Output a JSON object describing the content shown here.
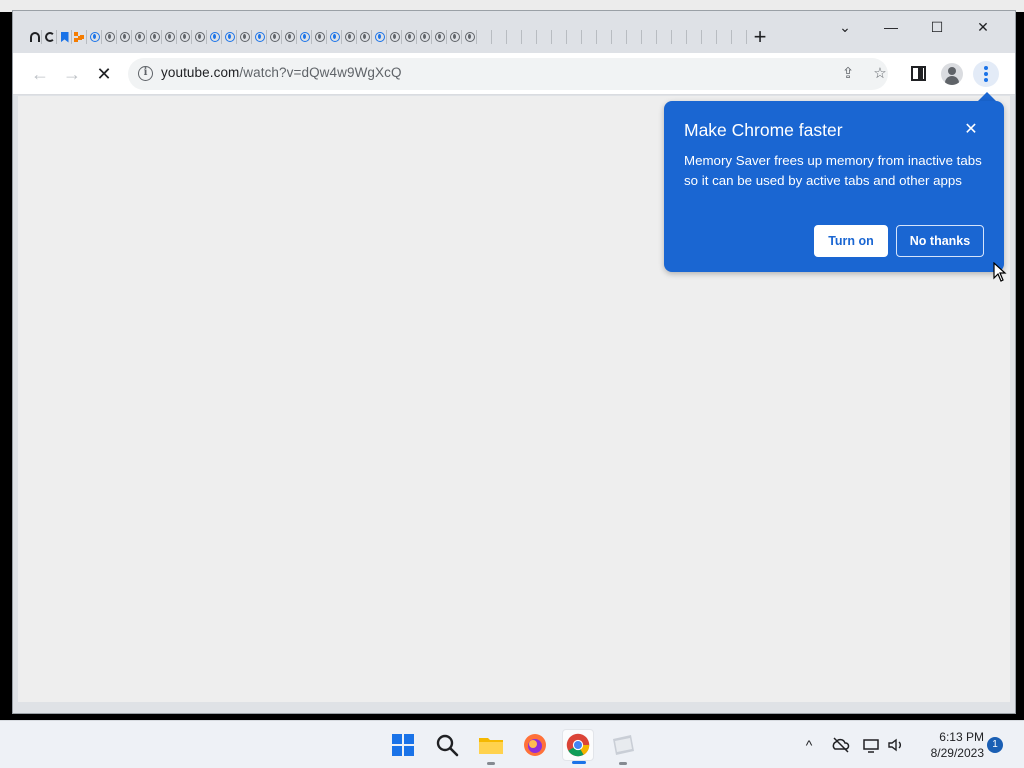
{
  "browser": {
    "tabstrip": {
      "tab_favicons": [
        "headset-icon",
        "reload-icon",
        "bookmark-icon",
        "orange-puzzle-icon",
        "globe-blue-icon",
        "globe-icon",
        "globe-icon",
        "globe-icon",
        "globe-icon",
        "globe-icon",
        "globe-icon",
        "globe-icon",
        "globe-blue-icon",
        "globe-blue-icon",
        "globe-icon",
        "globe-blue-icon",
        "globe-icon",
        "globe-icon",
        "globe-blue-icon",
        "globe-icon",
        "globe-blue-icon",
        "globe-icon",
        "globe-icon",
        "globe-blue-icon",
        "globe-icon",
        "globe-icon",
        "globe-icon",
        "globe-icon",
        "globe-icon",
        "globe-icon",
        "globe-icon",
        "globe-icon",
        "globe-icon",
        "globe-icon",
        "globe-icon",
        "globe-icon",
        "globe-icon",
        "globe-icon",
        "globe-icon",
        "globe-icon",
        "globe-icon",
        "globe-icon",
        "globe-icon",
        "globe-icon",
        "globe-icon",
        "globe-icon",
        "globe-icon",
        "globe-icon"
      ],
      "new_tab_label": "+"
    },
    "window_controls": {
      "tab_search": "⌄",
      "minimize": "—",
      "maximize": "☐",
      "close": "✕"
    },
    "toolbar": {
      "back": "←",
      "forward": "→",
      "stop": "✕",
      "url_host": "youtube.com",
      "url_path": "/watch?v=dQw4w9WgXcQ",
      "share": "⇪",
      "bookmark": "☆"
    }
  },
  "promo": {
    "title": "Make Chrome faster",
    "body": "Memory Saver frees up memory from inactive tabs so it can be used by active tabs and other apps",
    "close": "✕",
    "primary_button": "Turn on",
    "secondary_button": "No thanks",
    "color": "#1a66d2"
  },
  "taskbar": {
    "apps": [
      "start-icon",
      "search-icon",
      "file-explorer-icon",
      "firefox-icon",
      "chrome-icon",
      "app-icon"
    ],
    "tray": {
      "chevron": "^",
      "time": "6:13 PM",
      "date": "8/29/2023",
      "notifications": "1"
    }
  }
}
